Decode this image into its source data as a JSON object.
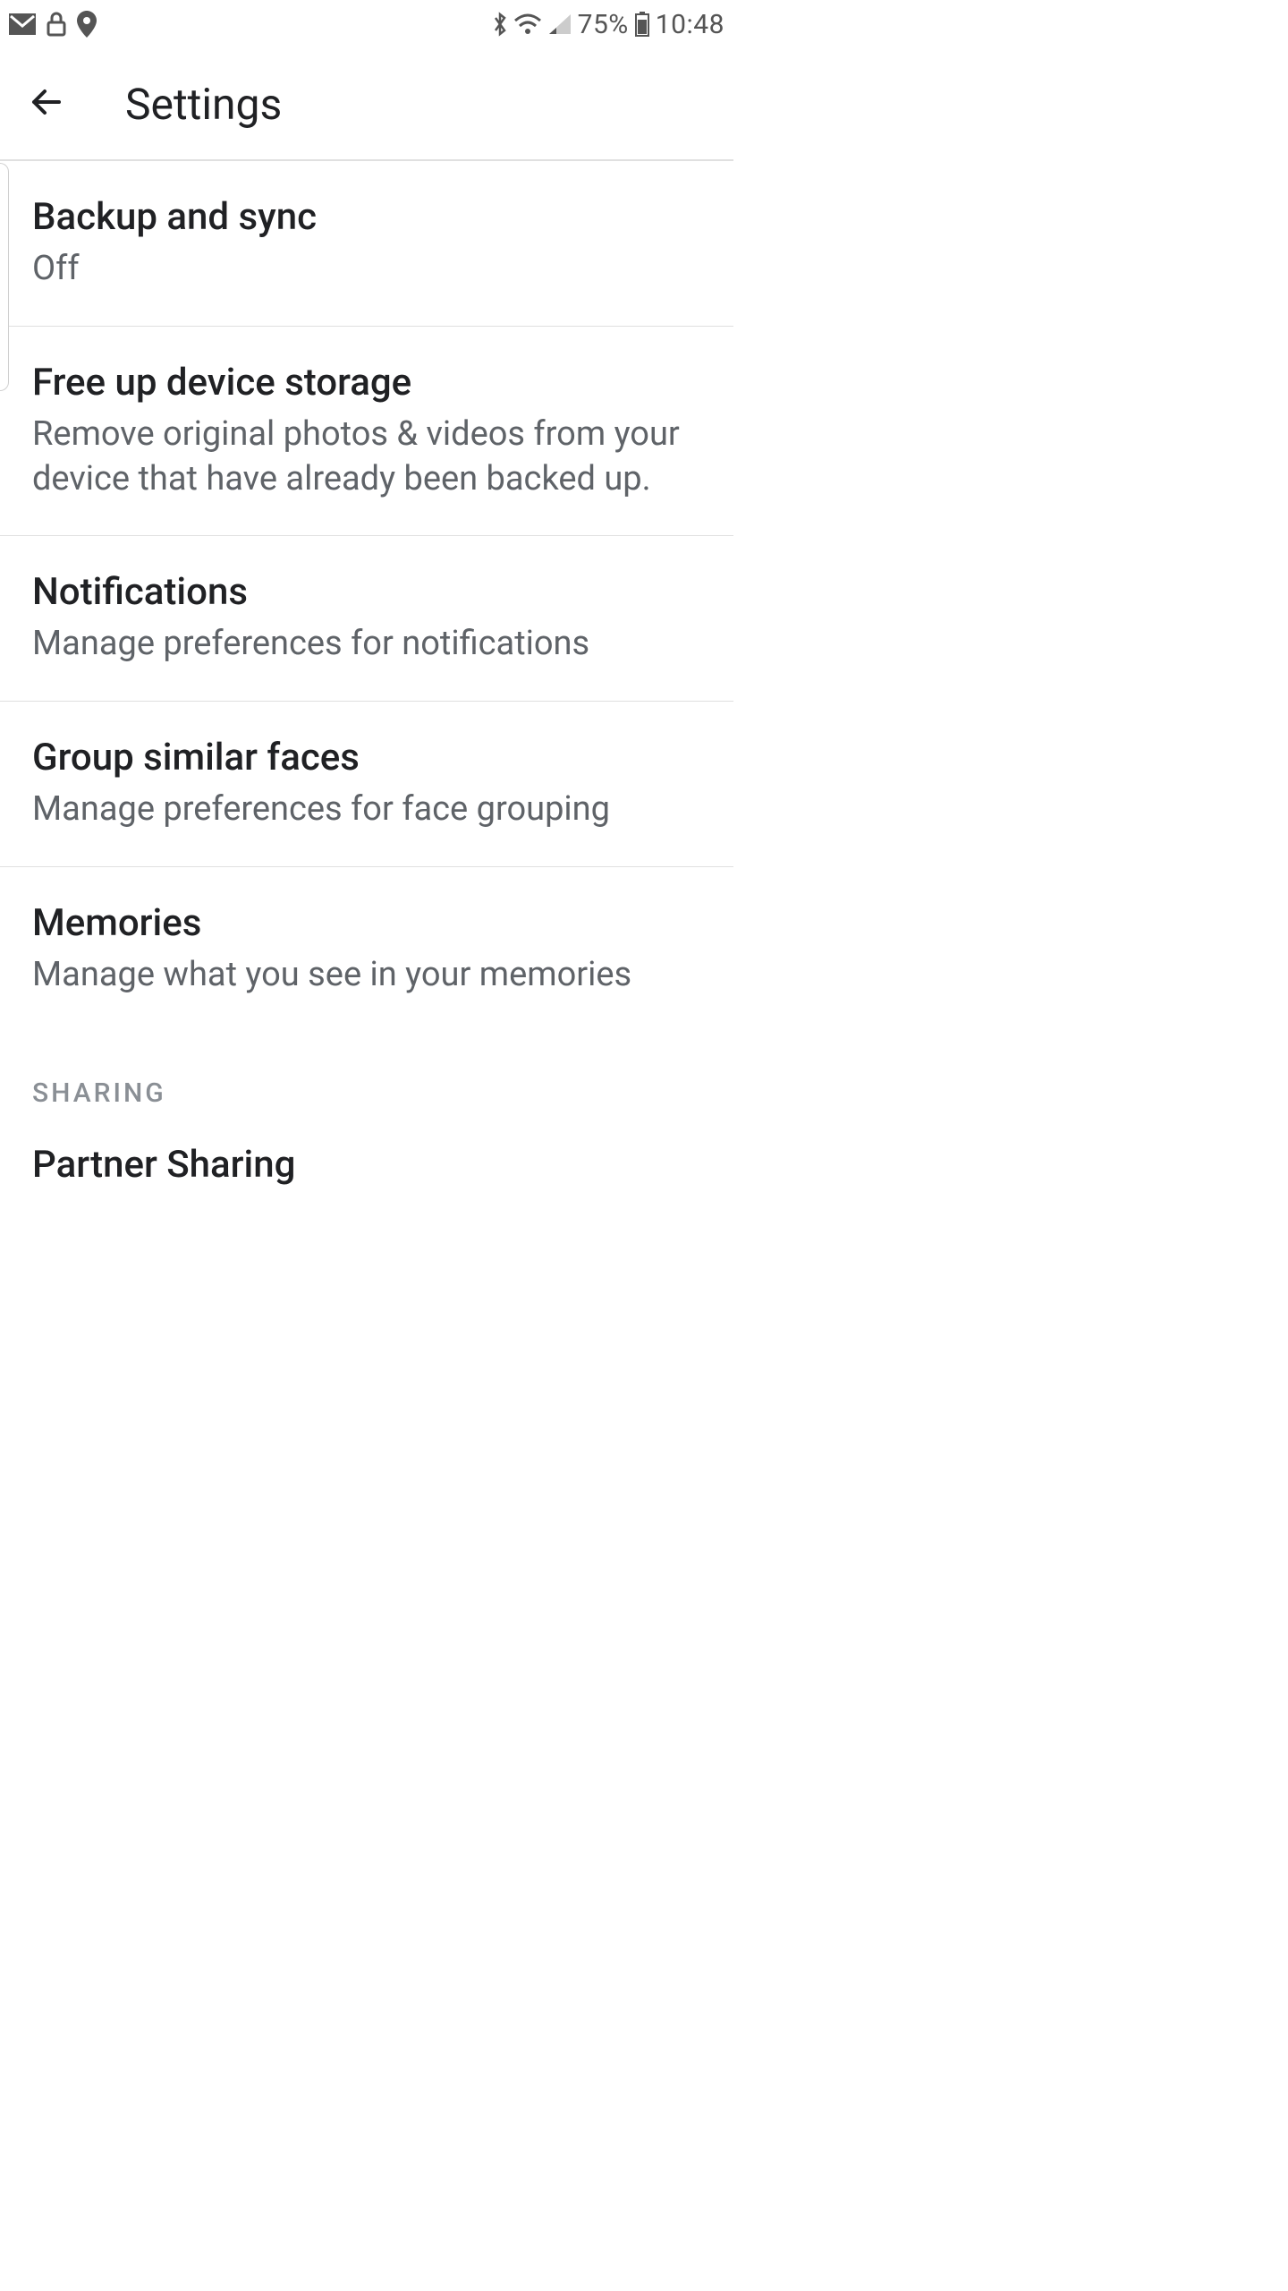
{
  "status": {
    "battery": "75%",
    "time": "10:48"
  },
  "header": {
    "title": "Settings"
  },
  "items": [
    {
      "title": "Backup and sync",
      "subtitle": "Off"
    },
    {
      "title": "Free up device storage",
      "subtitle": "Remove original photos & videos from your device that have already been backed up."
    },
    {
      "title": "Notifications",
      "subtitle": "Manage preferences for notifications"
    },
    {
      "title": "Group similar faces",
      "subtitle": "Manage preferences for face grouping"
    },
    {
      "title": "Memories",
      "subtitle": "Manage what you see in your memories"
    }
  ],
  "section": {
    "label": "SHARING"
  },
  "partner": {
    "title": "Partner Sharing"
  }
}
